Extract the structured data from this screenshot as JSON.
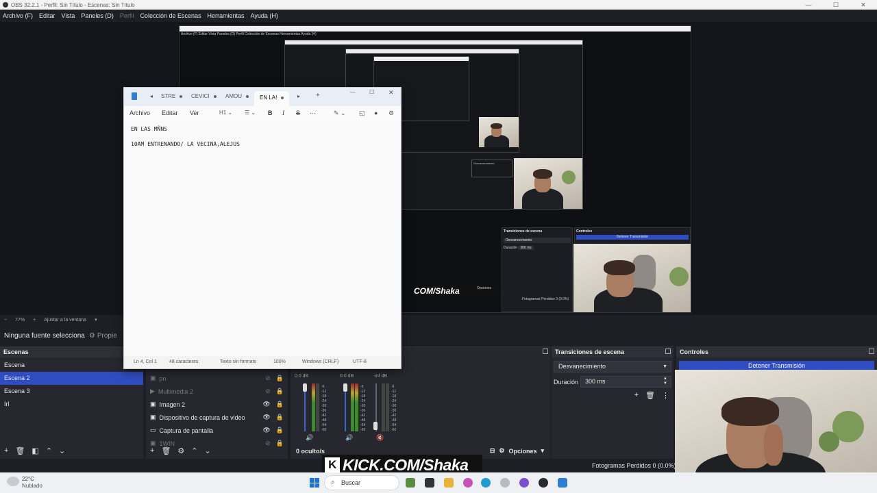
{
  "window": {
    "title": "OBS 32.2.1 - Perfil: Sin Título - Escenas: Sin Título"
  },
  "menu": [
    "Archivo (F)",
    "Editar",
    "Vista",
    "Paneles (D)",
    "Perfil",
    "Colección de Escenas",
    "Herramientas",
    "Ayuda (H)"
  ],
  "preview_nested": {
    "menu_text": "Archivo (F)  Editar  Vista  Paneles (D)  Perfil  Colección de Escenas  Herramientas  Ayuda (H)",
    "transitions_title": "Transiciones de escena",
    "controls_title": "Controles",
    "fade": "Desvanecimiento",
    "duration_label": "Duración",
    "duration_value": "300 ms",
    "stop_label": "Detener Transmisión",
    "options": "Opciones",
    "frames": "Fotogramas Perdidos 0 (0.0%)",
    "kick_text": "COM/Shaka"
  },
  "zoom": {
    "value": "77%",
    "fit": "Ajustar a la ventana"
  },
  "sourcebar": {
    "no_source": "Ninguna fuente selecciona",
    "properties": "Propie"
  },
  "scenes": {
    "title": "Escenas",
    "items": [
      "Escena",
      "Escena 2",
      "Escena 3",
      "Irl"
    ],
    "selected_index": 1
  },
  "sources": {
    "items": [
      {
        "name": "pn",
        "icon": "image-icon",
        "visible": false
      },
      {
        "name": "Multimedia 2",
        "icon": "play-icon",
        "visible": false
      },
      {
        "name": "Imagen 2",
        "icon": "image-icon",
        "visible": true
      },
      {
        "name": "Dispositivo de captura de video",
        "icon": "camera-icon",
        "visible": true
      },
      {
        "name": "Captura de pantalla",
        "icon": "monitor-icon",
        "visible": true
      },
      {
        "name": "1WIN",
        "icon": "image-icon",
        "visible": false
      }
    ]
  },
  "mixer": {
    "channels": [
      {
        "db": "0.0 dB"
      },
      {
        "db": "0.0 dB"
      },
      {
        "db": "-inf dB"
      }
    ],
    "scale": [
      "-6",
      "-12",
      "-18",
      "-24",
      "-30",
      "-36",
      "-42",
      "-48",
      "-54",
      "-60"
    ],
    "hidden": "0 oculto/s",
    "options": "Opciones"
  },
  "transitions": {
    "title": "Transiciones de escena",
    "selected": "Desvanecimiento",
    "duration_label": "Duración",
    "duration_value": "300 ms"
  },
  "controls": {
    "title": "Controles",
    "stop_stream": "Detener Transmisión"
  },
  "status": {
    "frames_dropped": "Fotogramas Perdidos 0 (0.0%)"
  },
  "overlay": {
    "kick": "KICK.COM/Shaka"
  },
  "notepad": {
    "tabs": [
      "STRE",
      "CEVICI",
      "AMOU",
      "EN LA!"
    ],
    "active_tab": "EN LA!",
    "menu": [
      "Archivo",
      "Editar",
      "Ver"
    ],
    "heading": "H1",
    "lines": [
      "EN LAS MÑNS",
      "",
      "10AM ENTRENANDO/ LA VECINA,ALEJUS"
    ],
    "status": {
      "position": "Ln 4, Col 1",
      "chars": "48 caracteres.",
      "format": "Texto sin formato",
      "zoom": "100%",
      "eol": "Windows (CRLF)",
      "encoding": "UTF-8"
    }
  },
  "taskbar": {
    "weather_temp": "22°C",
    "weather_desc": "Nublado",
    "search": "Buscar"
  }
}
